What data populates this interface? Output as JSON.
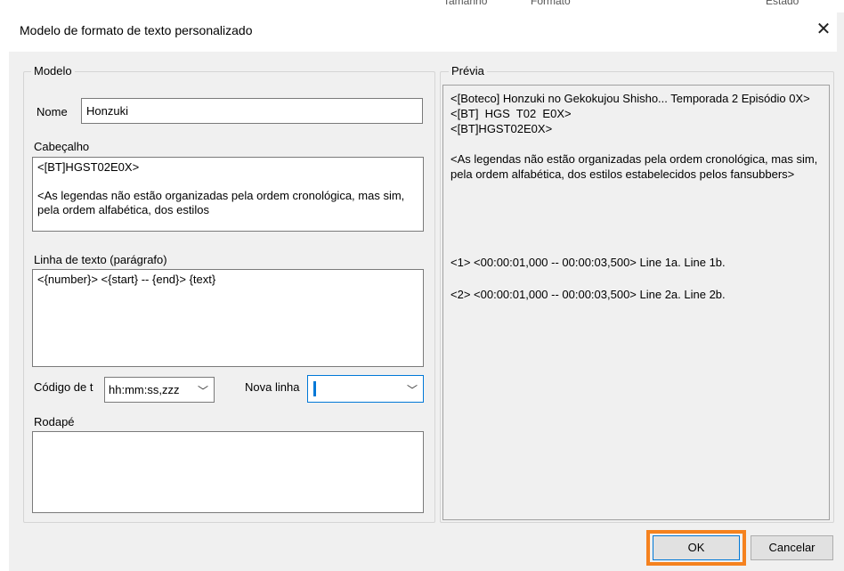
{
  "background": {
    "header_fragments": [
      "Tamanho",
      "Formato",
      "Estado"
    ]
  },
  "dialog": {
    "title": "Modelo de formato de texto personalizado",
    "close_label": "✕"
  },
  "model": {
    "group_label": "Modelo",
    "name_label": "Nome",
    "name_value": "Honzuki",
    "header_label": "Cabeçalho",
    "header_value": "<[BT]HGST02E0X>\n\n<As legendas não estão organizadas pela ordem cronológica, mas sim, pela ordem alfabética, dos estilos",
    "line_label": "Linha de texto (parágrafo)",
    "line_value": "<{number}> <{start} -- {end}> {text}",
    "timecode_label": "Código de t",
    "timecode_value": "hh:mm:ss,zzz",
    "newline_label": "Nova linha",
    "newline_value": "",
    "footer_label": "Rodapé",
    "footer_value": ""
  },
  "preview": {
    "group_label": "Prévia",
    "lines": [
      "<[Boteco] Honzuki no Gekokujou Shisho... Temporada 2 Episódio 0X>",
      "<[BT]  HGS  T02  E0X>",
      "<[BT]HGST02E0X>",
      "",
      "<As legendas não estão organizadas pela ordem cronológica, mas sim, pela ordem alfabética, dos estilos estabelecidos pelos fansubbers>",
      "",
      "",
      "",
      "",
      "",
      "<1> <00:00:01,000 -- 00:00:03,500> Line 1a. Line 1b.",
      "",
      "<2> <00:00:01,000 -- 00:00:03,500> Line 2a. Line 2b."
    ]
  },
  "buttons": {
    "ok": "OK",
    "cancel": "Cancelar"
  },
  "colors": {
    "ok_highlight": "#f5821f",
    "focus_border": "#0078d7"
  },
  "icons": {
    "close": "close-icon",
    "dropdown": "chevron-down-icon"
  }
}
